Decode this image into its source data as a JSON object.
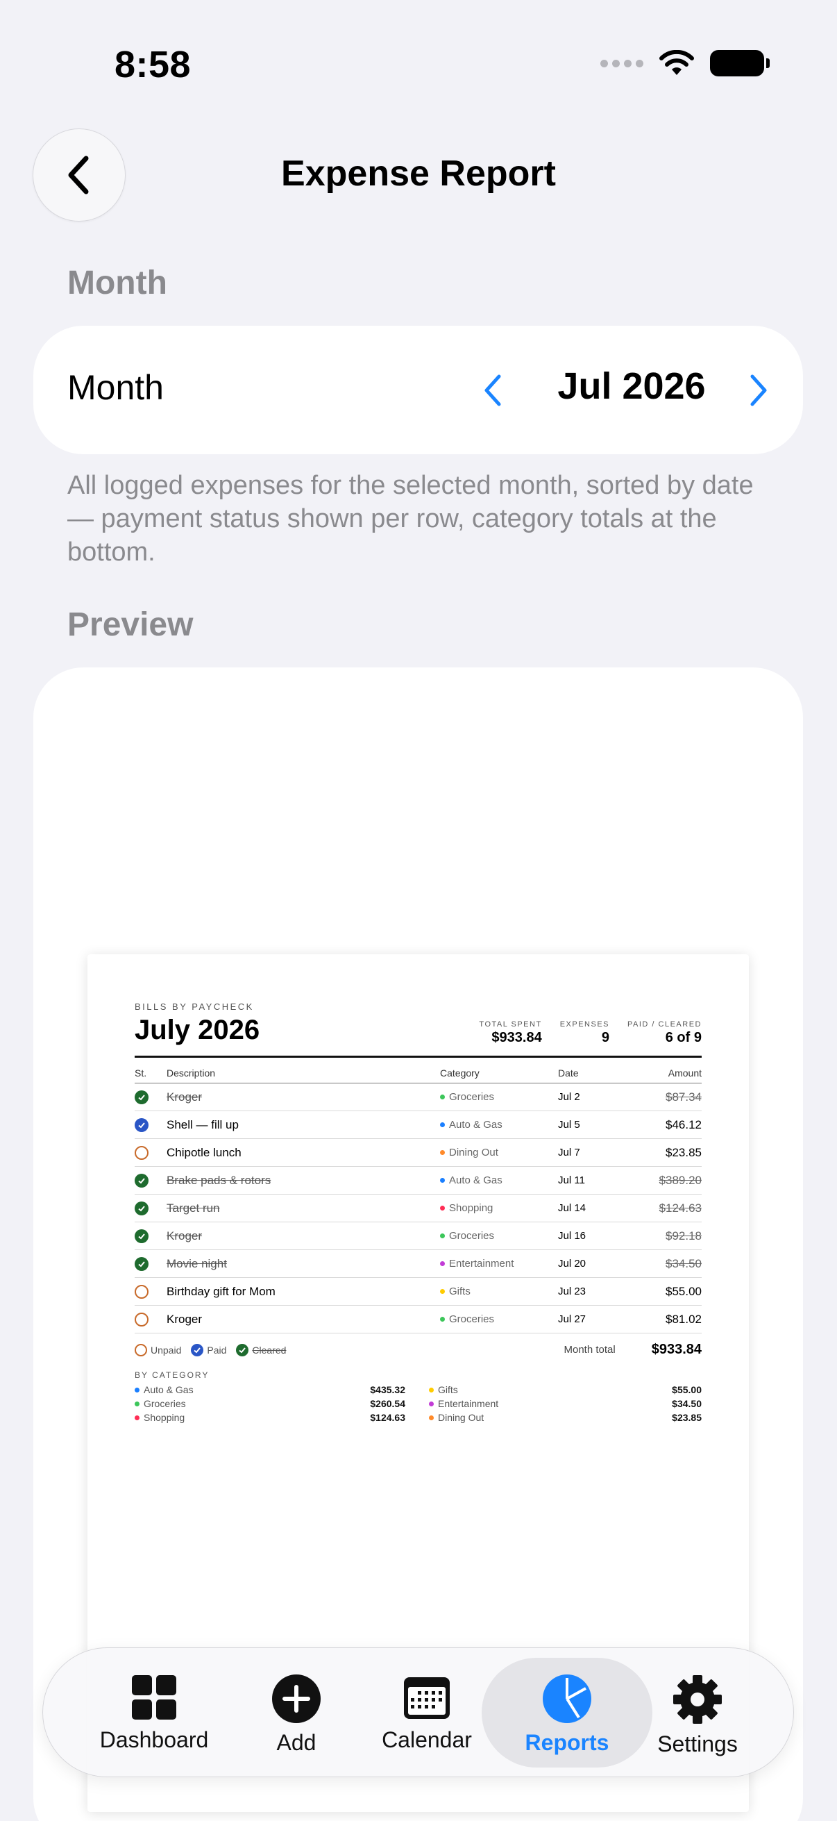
{
  "status": {
    "time": "8:58"
  },
  "nav": {
    "title": "Expense Report"
  },
  "sections": {
    "month": "Month",
    "preview": "Preview"
  },
  "month_picker": {
    "label": "Month",
    "value": "Jul 2026"
  },
  "helper_text": "All logged expenses for the selected month, sorted by date — payment status shown per row, category totals at the bottom.",
  "report": {
    "kicker": "BILLS BY PAYCHECK",
    "title": "July 2026",
    "stats": [
      {
        "label": "TOTAL SPENT",
        "value": "$933.84"
      },
      {
        "label": "EXPENSES",
        "value": "9"
      },
      {
        "label": "PAID / CLEARED",
        "value": "6 of 9"
      }
    ],
    "columns": {
      "status": "St.",
      "description": "Description",
      "category": "Category",
      "date": "Date",
      "amount": "Amount"
    },
    "rows": [
      {
        "status": "cleared",
        "description": "Kroger",
        "category": "Groceries",
        "cat_color": "#3cc65a",
        "date": "Jul 2",
        "amount": "$87.34"
      },
      {
        "status": "paid",
        "description": "Shell — fill up",
        "category": "Auto & Gas",
        "cat_color": "#1a7fff",
        "date": "Jul 5",
        "amount": "$46.12"
      },
      {
        "status": "unpaid",
        "description": "Chipotle lunch",
        "category": "Dining Out",
        "cat_color": "#ff8a2a",
        "date": "Jul 7",
        "amount": "$23.85"
      },
      {
        "status": "cleared",
        "description": "Brake pads & rotors",
        "category": "Auto & Gas",
        "cat_color": "#1a7fff",
        "date": "Jul 11",
        "amount": "$389.20"
      },
      {
        "status": "cleared",
        "description": "Target run",
        "category": "Shopping",
        "cat_color": "#ff2d55",
        "date": "Jul 14",
        "amount": "$124.63"
      },
      {
        "status": "cleared",
        "description": "Kroger",
        "category": "Groceries",
        "cat_color": "#3cc65a",
        "date": "Jul 16",
        "amount": "$92.18"
      },
      {
        "status": "cleared",
        "description": "Movie night",
        "category": "Entertainment",
        "cat_color": "#c23cd6",
        "date": "Jul 20",
        "amount": "$34.50"
      },
      {
        "status": "unpaid",
        "description": "Birthday gift for Mom",
        "category": "Gifts",
        "cat_color": "#ffcc00",
        "date": "Jul 23",
        "amount": "$55.00"
      },
      {
        "status": "unpaid",
        "description": "Kroger",
        "category": "Groceries",
        "cat_color": "#3cc65a",
        "date": "Jul 27",
        "amount": "$81.02"
      }
    ],
    "legend": {
      "unpaid": "Unpaid",
      "paid": "Paid",
      "cleared": "Cleared"
    },
    "month_total_label": "Month total",
    "month_total": "$933.84",
    "by_category_label": "BY CATEGORY",
    "by_category": [
      {
        "name": "Auto & Gas",
        "color": "#1a7fff",
        "amount": "$435.32"
      },
      {
        "name": "Gifts",
        "color": "#ffcc00",
        "amount": "$55.00"
      },
      {
        "name": "Groceries",
        "color": "#3cc65a",
        "amount": "$260.54"
      },
      {
        "name": "Entertainment",
        "color": "#c23cd6",
        "amount": "$34.50"
      },
      {
        "name": "Shopping",
        "color": "#ff2d55",
        "amount": "$124.63"
      },
      {
        "name": "Dining Out",
        "color": "#ff8a2a",
        "amount": "$23.85"
      }
    ]
  },
  "tabbar": {
    "active_color": "#1a84ff",
    "tabs": [
      {
        "label": "Dashboard",
        "icon": "grid-icon"
      },
      {
        "label": "Add",
        "icon": "plus-circle-icon"
      },
      {
        "label": "Calendar",
        "icon": "calendar-icon"
      },
      {
        "label": "Reports",
        "icon": "pie-chart-icon",
        "active": true
      },
      {
        "label": "Settings",
        "icon": "gear-icon"
      }
    ]
  }
}
